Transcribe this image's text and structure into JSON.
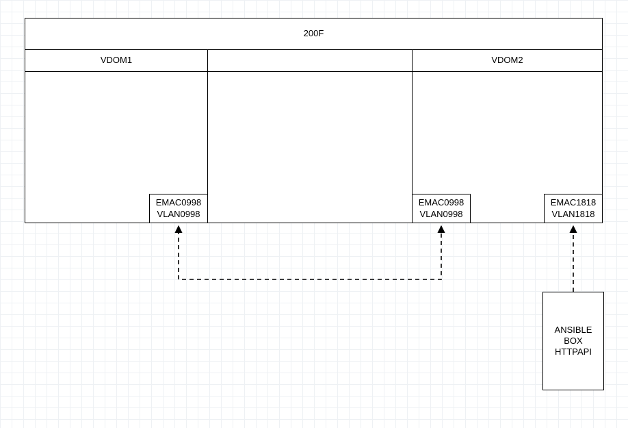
{
  "diagram": {
    "device_title": "200F",
    "vdom1_title": "VDOM1",
    "vdom2_title": "VDOM2",
    "port_vdom1": {
      "line1": "EMAC0998",
      "line2": "VLAN0998"
    },
    "port_vdom2_left": {
      "line1": "EMAC0998",
      "line2": "VLAN0998"
    },
    "port_vdom2_right": {
      "line1": "EMAC1818",
      "line2": "VLAN1818"
    },
    "ansible_box": {
      "line1": "ANSIBLE",
      "line2": "BOX",
      "line3": "HTTPAPI"
    },
    "connections": [
      {
        "from": "ansible-box",
        "to": "port-vdom2-right",
        "style": "dashed-arrow"
      },
      {
        "from": "port-vdom2-right",
        "to": "port-vdom2-left",
        "style": "dashed-arrow"
      },
      {
        "from": "port-vdom2-left",
        "to": "port-vdom1",
        "style": "dashed-arrow-elbow"
      }
    ]
  }
}
